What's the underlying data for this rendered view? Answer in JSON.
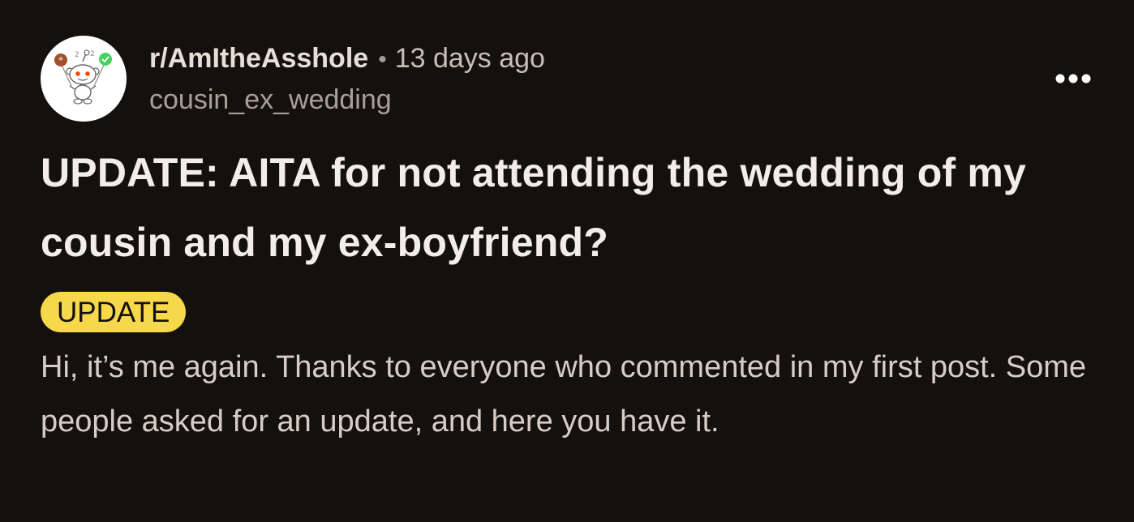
{
  "post": {
    "subreddit": "r/AmItheAsshole",
    "separator": "•",
    "time_ago": "13 days ago",
    "username": "cousin_ex_wedding",
    "title": "UPDATE: AITA for not attending the wedding of my cousin and my ex-boyfriend?",
    "flair": "UPDATE",
    "body": "Hi, it’s me again. Thanks to everyone who commented in my first post. Some people asked for an update, and here you have it."
  },
  "icons": {
    "avatar": "subreddit-snoo-avatar-icon",
    "more": "more-options-icon"
  },
  "colors": {
    "background": "#14100e",
    "flair_background": "#f6d84a",
    "title_text": "#f3ede7",
    "body_text": "#d6cec6"
  }
}
